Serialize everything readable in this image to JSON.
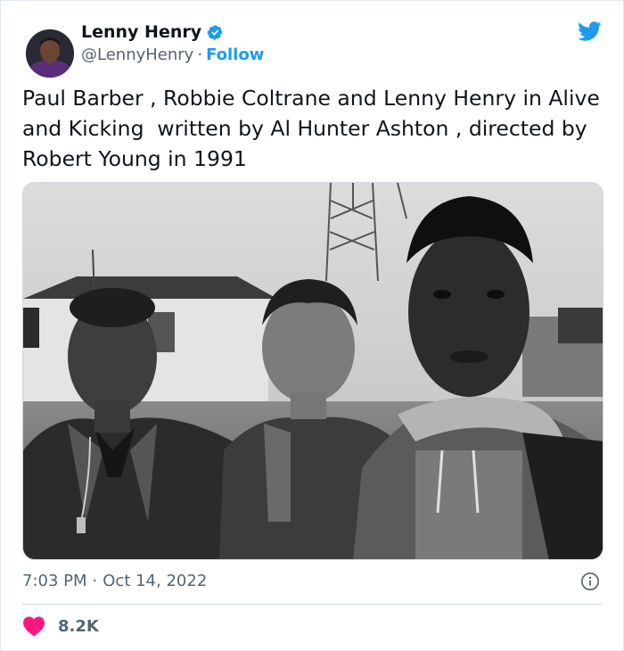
{
  "author": {
    "display_name": "Lenny Henry",
    "handle": "@LennyHenry",
    "separator": "·",
    "follow_label": "Follow"
  },
  "tweet": {
    "text": "Paul Barber , Robbie Coltrane and Lenny Henry in Alive and Kicking  written by Al Hunter Ashton , directed by Robert Young in 1991",
    "time": "7:03 PM",
    "separator": "·",
    "date": "Oct 14, 2022"
  },
  "engagement": {
    "likes": "8.2K"
  },
  "icons": {
    "verified": "verified-badge-icon",
    "platform": "twitter-bird-icon",
    "info": "info-icon",
    "like": "heart-icon"
  },
  "colors": {
    "accent": "#1d9bf0",
    "like": "#f91880",
    "text_primary": "#0f1419",
    "text_secondary": "#536471",
    "divider": "#cfd9de"
  }
}
